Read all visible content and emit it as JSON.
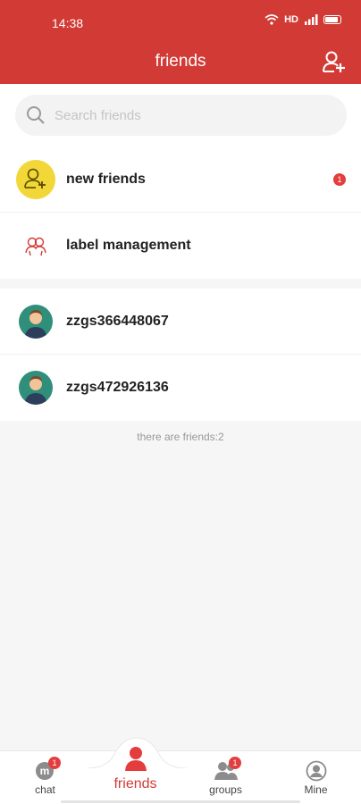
{
  "status_bar": {
    "time": "14:38",
    "network": "HD"
  },
  "header": {
    "title": "friends"
  },
  "search": {
    "placeholder": "Search friends"
  },
  "special_items": [
    {
      "label": "new friends",
      "badge": "1"
    },
    {
      "label": "label management"
    }
  ],
  "friends": [
    {
      "name": "zzgs366448067"
    },
    {
      "name": "zzgs472926136"
    }
  ],
  "friend_count_text": "there are friends:2",
  "bottom_nav": [
    {
      "label": "chat",
      "badge": "1",
      "active": false
    },
    {
      "label": "friends",
      "active": true
    },
    {
      "label": "groups",
      "badge": "1",
      "active": false
    },
    {
      "label": "Mine",
      "active": false
    }
  ],
  "colors": {
    "brand": "#d23a35",
    "badge": "#e43d3d",
    "new_friends_icon_bg": "#f2d738",
    "avatar_bg": "#2f8f7a"
  }
}
